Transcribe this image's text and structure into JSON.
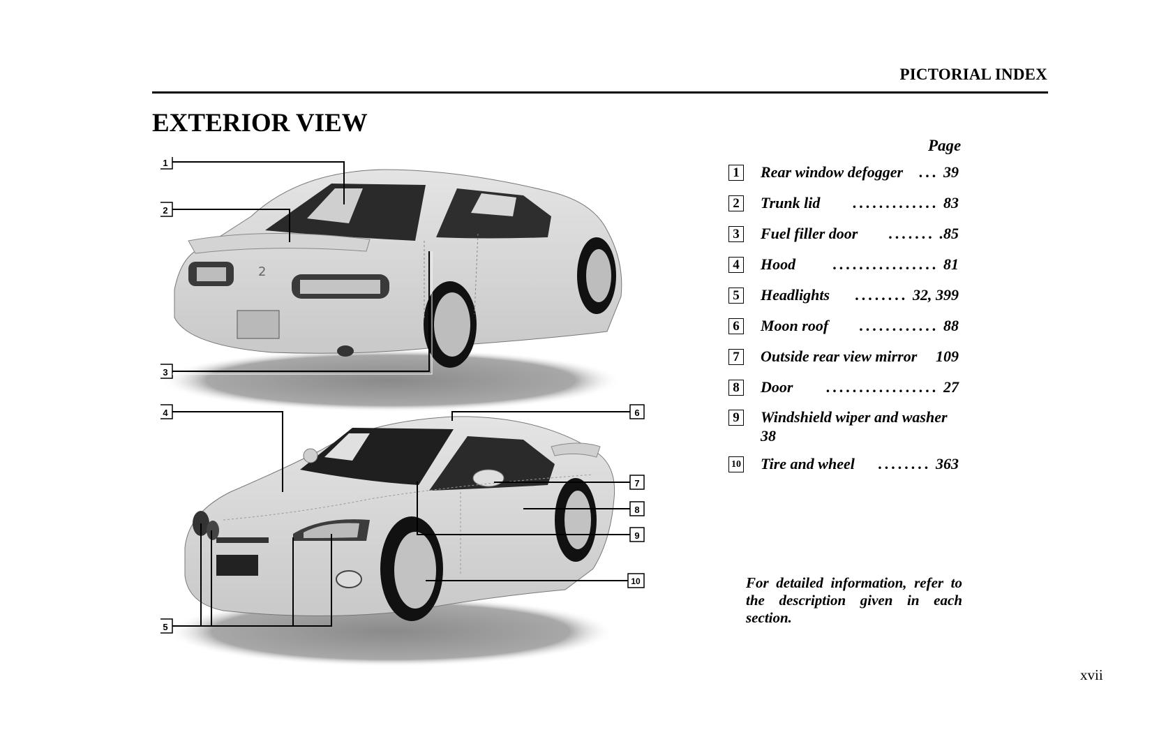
{
  "header": {
    "section": "PICTORIAL INDEX"
  },
  "title": "EXTERIOR VIEW",
  "page_column_label": "Page",
  "index_items": [
    {
      "number": "1",
      "label": "Rear window defogger",
      "leader": "...",
      "page": "39"
    },
    {
      "number": "2",
      "label": "Trunk lid",
      "leader": ".............",
      "page": "83"
    },
    {
      "number": "3",
      "label": "Fuel filler door",
      "leader": ".......",
      "page": ".85"
    },
    {
      "number": "4",
      "label": "Hood",
      "leader": "................",
      "page": "81"
    },
    {
      "number": "5",
      "label": "Headlights",
      "leader": "........",
      "page": "32, 399"
    },
    {
      "number": "6",
      "label": "Moon roof",
      "leader": "............",
      "page": "88"
    },
    {
      "number": "7",
      "label": "Outside rear view mirror",
      "leader": "",
      "page": "109"
    },
    {
      "number": "8",
      "label": "Door",
      "leader": ".................",
      "page": "27"
    },
    {
      "number": "9",
      "label": "Windshield wiper and washer",
      "leader": "",
      "page": "38"
    },
    {
      "number": "10",
      "label": "Tire and wheel",
      "leader": "........",
      "page": "363"
    }
  ],
  "figure": {
    "rear_view_callouts": [
      "1",
      "2",
      "3"
    ],
    "front_view_callouts": [
      "4",
      "5",
      "6",
      "7",
      "8",
      "9",
      "10"
    ]
  },
  "note": "For detailed information, refer to the description given in each section.",
  "page_number": "xvii"
}
